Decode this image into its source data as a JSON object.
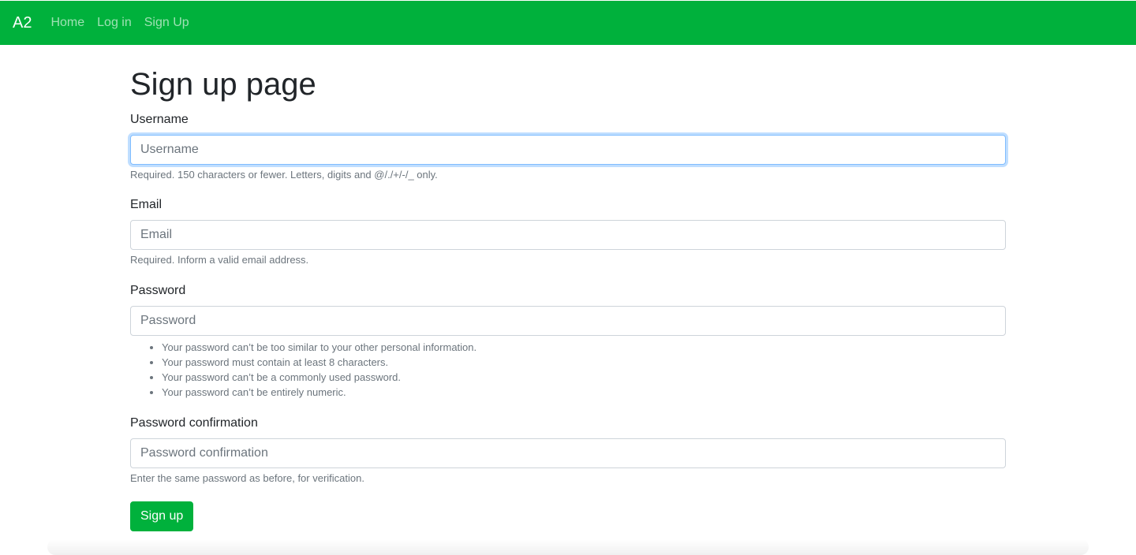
{
  "navbar": {
    "brand": "A2",
    "links": [
      "Home",
      "Log in",
      "Sign Up"
    ],
    "background_color": "#00b13c"
  },
  "page": {
    "title": "Sign up page"
  },
  "form": {
    "username": {
      "label": "Username",
      "placeholder": "Username",
      "value": "",
      "help": "Required. 150 characters or fewer. Letters, digits and @/./+/-/_ only."
    },
    "email": {
      "label": "Email",
      "placeholder": "Email",
      "value": "",
      "help": "Required. Inform a valid email address."
    },
    "password": {
      "label": "Password",
      "placeholder": "Password",
      "value": "",
      "help_items": [
        "Your password can’t be too similar to your other personal information.",
        "Your password must contain at least 8 characters.",
        "Your password can’t be a commonly used password.",
        "Your password can’t be entirely numeric."
      ]
    },
    "password_confirmation": {
      "label": "Password confirmation",
      "placeholder": "Password confirmation",
      "value": "",
      "help": "Enter the same password as before, for verification."
    },
    "submit_label": "Sign up",
    "accent_color": "#00b13c"
  }
}
